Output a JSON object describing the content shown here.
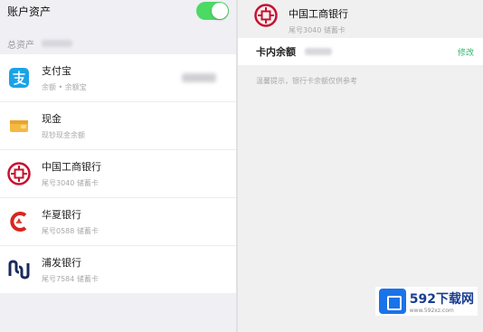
{
  "left": {
    "toggle_label": "账户资产",
    "section_title": "总资产",
    "accounts": [
      {
        "name": "支付宝",
        "sub": "余额 • 余额宝",
        "icon": "alipay-icon"
      },
      {
        "name": "现金",
        "sub": "现钞现金余额",
        "icon": "cash-wallet-icon"
      },
      {
        "name": "中国工商银行",
        "sub": "尾号3040  储蓄卡",
        "icon": "icbc-logo-icon"
      },
      {
        "name": "华夏银行",
        "sub": "尾号0588  储蓄卡",
        "icon": "huaxia-bank-logo-icon"
      },
      {
        "name": "浦发银行",
        "sub": "尾号7584  储蓄卡",
        "icon": "spdb-logo-icon"
      }
    ]
  },
  "right": {
    "bank_name": "中国工商银行",
    "bank_sub": "尾号3040  储蓄卡",
    "balance_label": "卡内余额",
    "edit_label": "修改",
    "note": "温馨提示，银行卡余额仅供参考"
  },
  "watermark": {
    "title": "592下载网",
    "url": "www.592xz.com"
  },
  "colors": {
    "toggle_on": "#4cd964",
    "accent_green": "#34b56f",
    "icbc_red": "#c8102e",
    "alipay_blue": "#1aa3e8",
    "cash_yellow": "#f4b843",
    "huaxia_red": "#d7261e",
    "spdb_navy": "#1a2a5c"
  }
}
